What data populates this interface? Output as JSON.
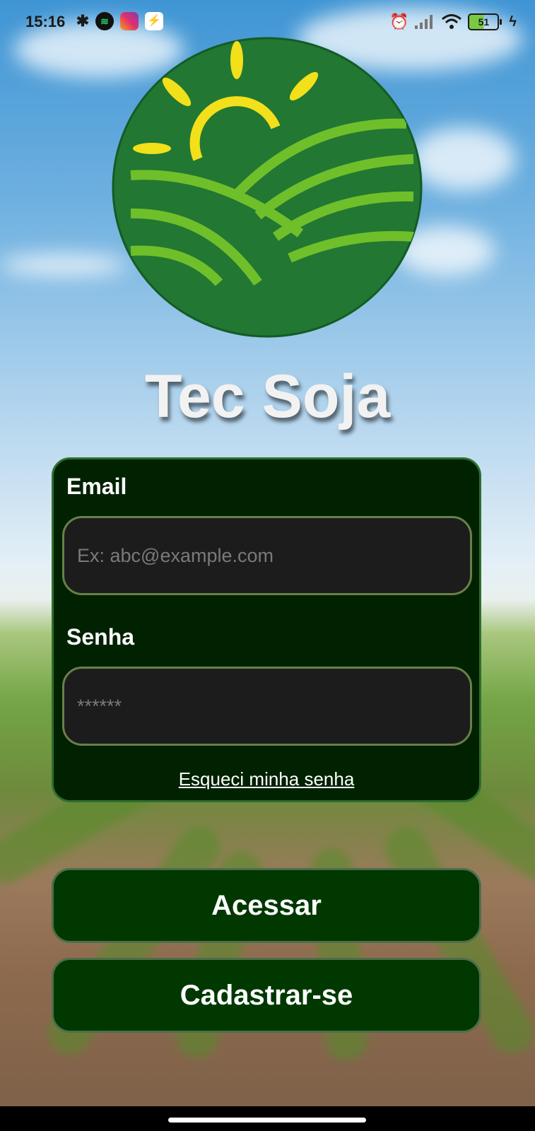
{
  "status_bar": {
    "time": "15:16",
    "icons": [
      "bluetooth-icon",
      "spotify-icon",
      "instagram-icon",
      "app-icon",
      "alarm-icon",
      "signal-icon",
      "wifi-icon",
      "battery-icon",
      "charging-icon"
    ],
    "battery_level": "51"
  },
  "app": {
    "title": "Tec Soja",
    "colors": {
      "card_bg": "#002200",
      "button_bg": "#003800",
      "logo_bg": "#227733",
      "logo_sun": "#f2e01a",
      "logo_field": "#6fbf2a"
    }
  },
  "login_form": {
    "email_label": "Email",
    "email_placeholder": "Ex: abc@example.com",
    "email_value": "",
    "password_label": "Senha",
    "password_placeholder": "******",
    "password_value": "",
    "forgot_password": "Esqueci minha senha"
  },
  "actions": {
    "login_button": "Acessar",
    "register_button": "Cadastrar-se"
  }
}
